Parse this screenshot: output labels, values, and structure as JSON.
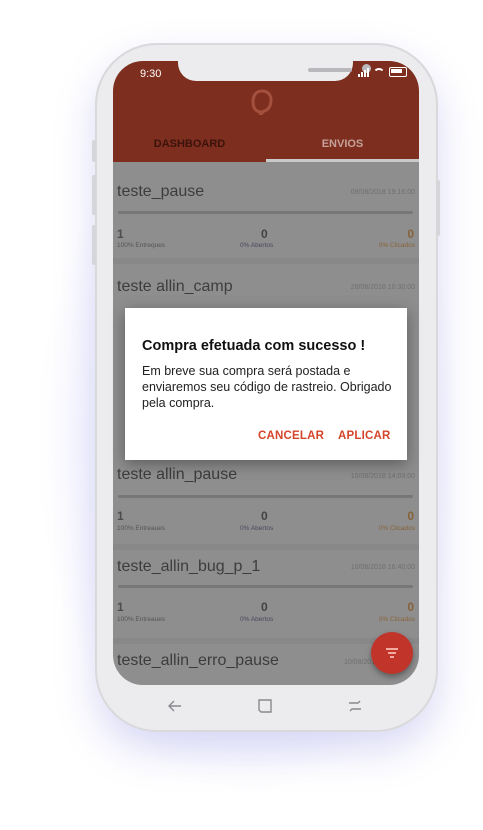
{
  "status_bar": {
    "time": "9:30"
  },
  "tabs": [
    {
      "label": "DASHBOARD"
    },
    {
      "label": "ENVIOS"
    }
  ],
  "campaigns": [
    {
      "name": "teste_pause",
      "date": "08/08/2018 19:16:00",
      "sent": "1",
      "sent_label": "100% Entreques",
      "opened": "0",
      "opened_label": "0% Abertos",
      "clicked": "0",
      "clicked_label": "0% Clicados"
    },
    {
      "name": "teste allin_camp",
      "date": "28/08/2018 10:30:00"
    },
    {
      "name": "teste allin_pause",
      "date": "10/08/2018 14:03:00",
      "sent": "1",
      "sent_label": "100% Entreaues",
      "opened": "0",
      "opened_label": "0% Abertos",
      "clicked": "0",
      "clicked_label": "0% Clicados"
    },
    {
      "name": "teste_allin_bug_p_1",
      "date": "10/08/2018 16:40:00",
      "sent": "1",
      "sent_label": "100% Entreaues",
      "opened": "0",
      "opened_label": "0% Abertos",
      "clicked": "0",
      "clicked_label": "0% Clicados"
    },
    {
      "name": "teste_allin_erro_pause",
      "date": "10/08/2018"
    }
  ],
  "dialog": {
    "title": "Compra efetuada com sucesso !",
    "message": "Em breve sua compra será postada e enviaremos seu código de rastreio. Obrigado pela compra.",
    "cancel_label": "CANCELAR",
    "apply_label": "APLICAR"
  },
  "colors": {
    "brand": "#7d2e1e",
    "accent": "#d4452a",
    "fab": "#c1342a"
  },
  "icons": {
    "fab": "filter-icon",
    "nav_back": "back-arrow-icon",
    "nav_home": "home-icon",
    "nav_recents": "recents-icon"
  }
}
